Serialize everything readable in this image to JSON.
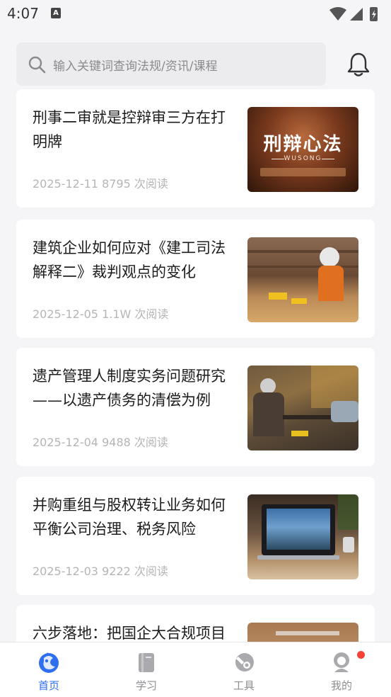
{
  "status_bar": {
    "time": "4:07",
    "notification_icon": "A"
  },
  "search": {
    "placeholder": "输入关键词查询法规/资讯/课程"
  },
  "articles": [
    {
      "title": "刑事二审就是控辩审三方在打明牌",
      "date": "2025-12-11",
      "views": "8795 次阅读",
      "thumb_text": "刑辩心法",
      "thumb_sub": "WUSONG"
    },
    {
      "title": "建筑企业如何应对《建工司法解释二》裁判观点的变化",
      "date": "2025-12-05",
      "views": "1.1W 次阅读"
    },
    {
      "title": "遗产管理人制度实务问题研究——以遗产债务的清偿为例",
      "date": "2025-12-04",
      "views": "9488 次阅读"
    },
    {
      "title": "并购重组与股权转让业务如何平衡公司治理、税务风险",
      "date": "2025-12-03",
      "views": "9222 次阅读"
    },
    {
      "title": "六步落地：把国企大合规项目",
      "date": "",
      "views": ""
    }
  ],
  "tabs": [
    {
      "label": "首页",
      "icon": "home-icon",
      "active": true
    },
    {
      "label": "学习",
      "icon": "book-icon",
      "active": false
    },
    {
      "label": "工具",
      "icon": "wrench-icon",
      "active": false
    },
    {
      "label": "我的",
      "icon": "profile-icon",
      "active": false
    }
  ],
  "colors": {
    "accent": "#2e6ff0",
    "badge": "#f44336"
  }
}
